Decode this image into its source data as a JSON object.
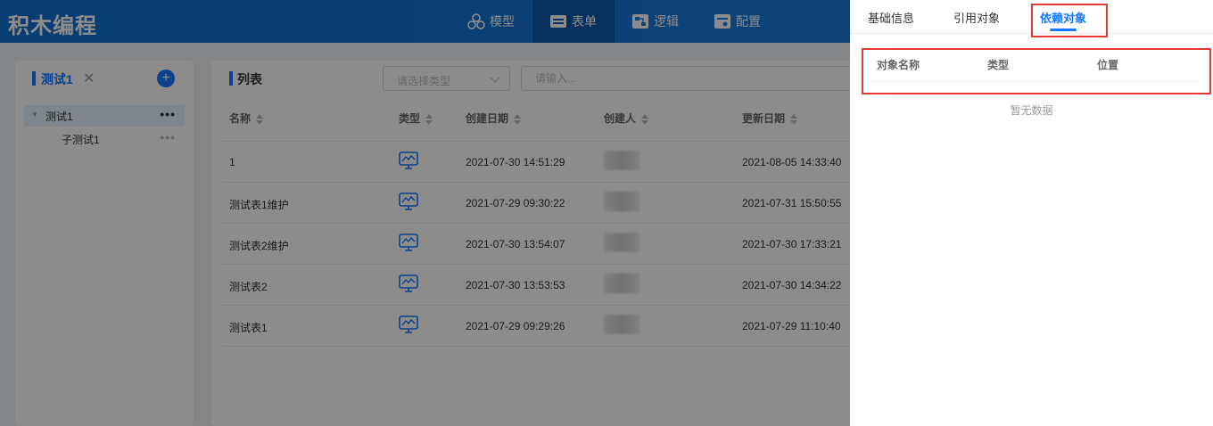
{
  "app": {
    "logo": "积木编程"
  },
  "nav": [
    {
      "label": "模型",
      "icon": "model-icon"
    },
    {
      "label": "表单",
      "icon": "form-icon",
      "active": true
    },
    {
      "label": "逻辑",
      "icon": "logic-icon"
    },
    {
      "label": "配置",
      "icon": "config-icon"
    }
  ],
  "sidebar": {
    "tab_label": "测试1",
    "close_glyph": "✕",
    "add_glyph": "+",
    "tree": [
      {
        "label": "测试1",
        "more": "•••"
      },
      {
        "label": "子测试1",
        "more": "•••"
      }
    ]
  },
  "list": {
    "title": "列表",
    "type_select_placeholder": "请选择类型",
    "search_placeholder": "请输入...",
    "columns": [
      "名称",
      "类型",
      "创建日期",
      "创建人",
      "更新日期"
    ],
    "rows": [
      {
        "name": "1",
        "type_icon": "monitor-chart-icon",
        "created": "2021-07-30 14:51:29",
        "updated": "2021-08-05 14:33:40"
      },
      {
        "name": "测试表1维护",
        "type_icon": "monitor-chart-icon",
        "created": "2021-07-29 09:30:22",
        "updated": "2021-07-31 15:50:55"
      },
      {
        "name": "测试表2维护",
        "type_icon": "monitor-chart-icon",
        "created": "2021-07-30 13:54:07",
        "updated": "2021-07-30 17:33:21"
      },
      {
        "name": "测试表2",
        "type_icon": "monitor-chart-icon",
        "created": "2021-07-30 13:53:53",
        "updated": "2021-07-30 14:34:22"
      },
      {
        "name": "测试表1",
        "type_icon": "monitor-chart-icon",
        "created": "2021-07-29 09:29:26",
        "updated": "2021-07-29 11:10:40"
      }
    ]
  },
  "drawer": {
    "tabs": [
      "基础信息",
      "引用对象",
      "依赖对象"
    ],
    "active_tab": "依赖对象",
    "columns": [
      "对象名称",
      "类型",
      "位置"
    ],
    "empty_text": "暂无数据"
  },
  "colors": {
    "header": "#1677ff",
    "accent": "#1677ff",
    "highlight_box": "#e53935"
  }
}
